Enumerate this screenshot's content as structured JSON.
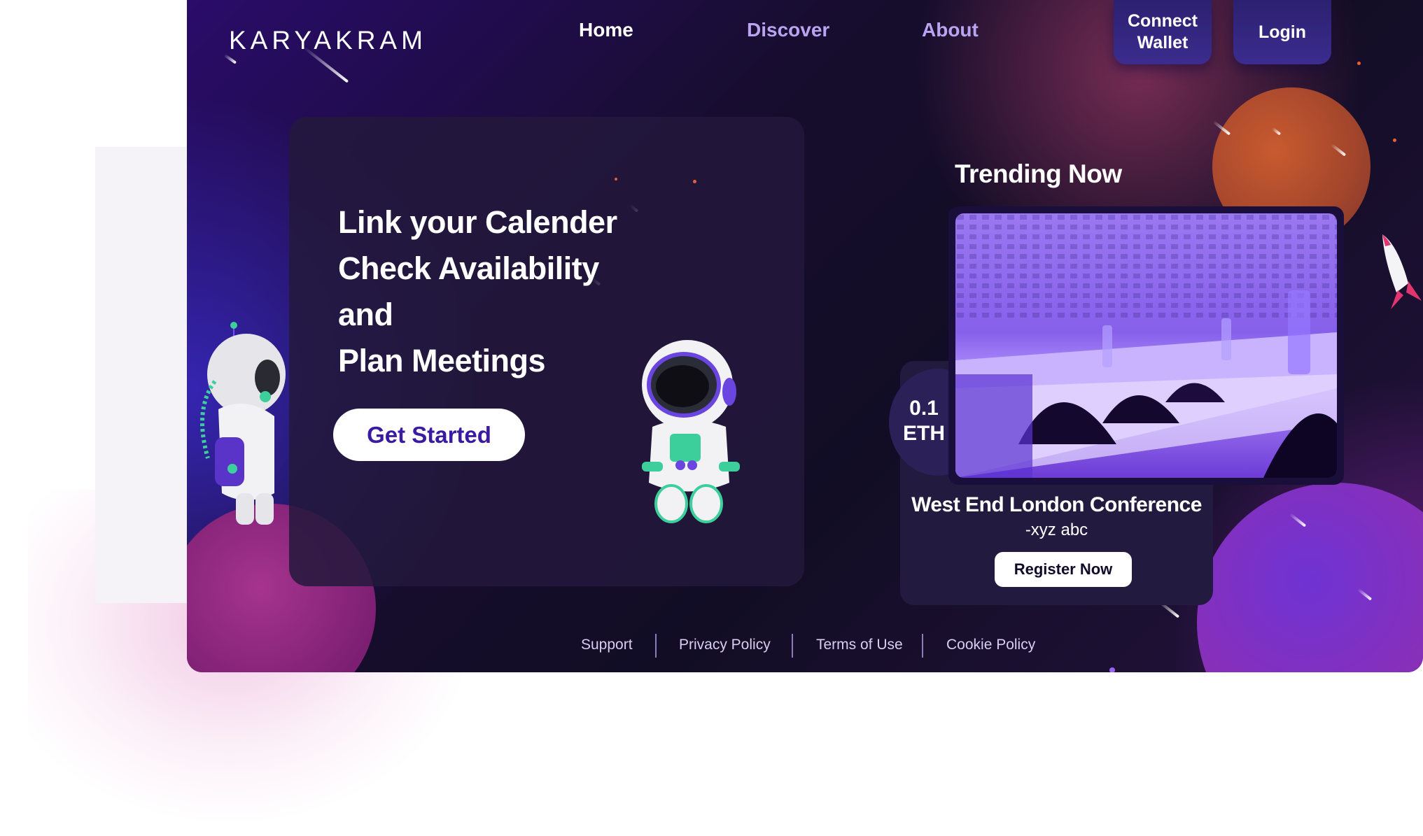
{
  "brand": {
    "logo_text": "KARYAKRAM"
  },
  "nav": {
    "home": "Home",
    "discover": "Discover",
    "about": "About"
  },
  "header_buttons": {
    "connect_wallet": "Connect\nWallet",
    "login": "Login"
  },
  "hero": {
    "lines": [
      "Link your Calender",
      "Check Availability",
      "and",
      "Plan Meetings"
    ],
    "cta": "Get Started"
  },
  "trending": {
    "title": "Trending Now",
    "event": {
      "price_amount": "0.1",
      "price_currency": "ETH",
      "name": "West End London Conference",
      "organizer": "-xyz abc",
      "register_label": "Register Now"
    }
  },
  "footer": {
    "links": [
      "Support",
      "Privacy Policy",
      "Terms of Use",
      "Cookie Policy"
    ]
  },
  "colors": {
    "accent_purple": "#3a1aa3",
    "nav_inactive": "#b9a4f1",
    "card_bg": "#221b3f",
    "background_dark": "#120d25"
  }
}
